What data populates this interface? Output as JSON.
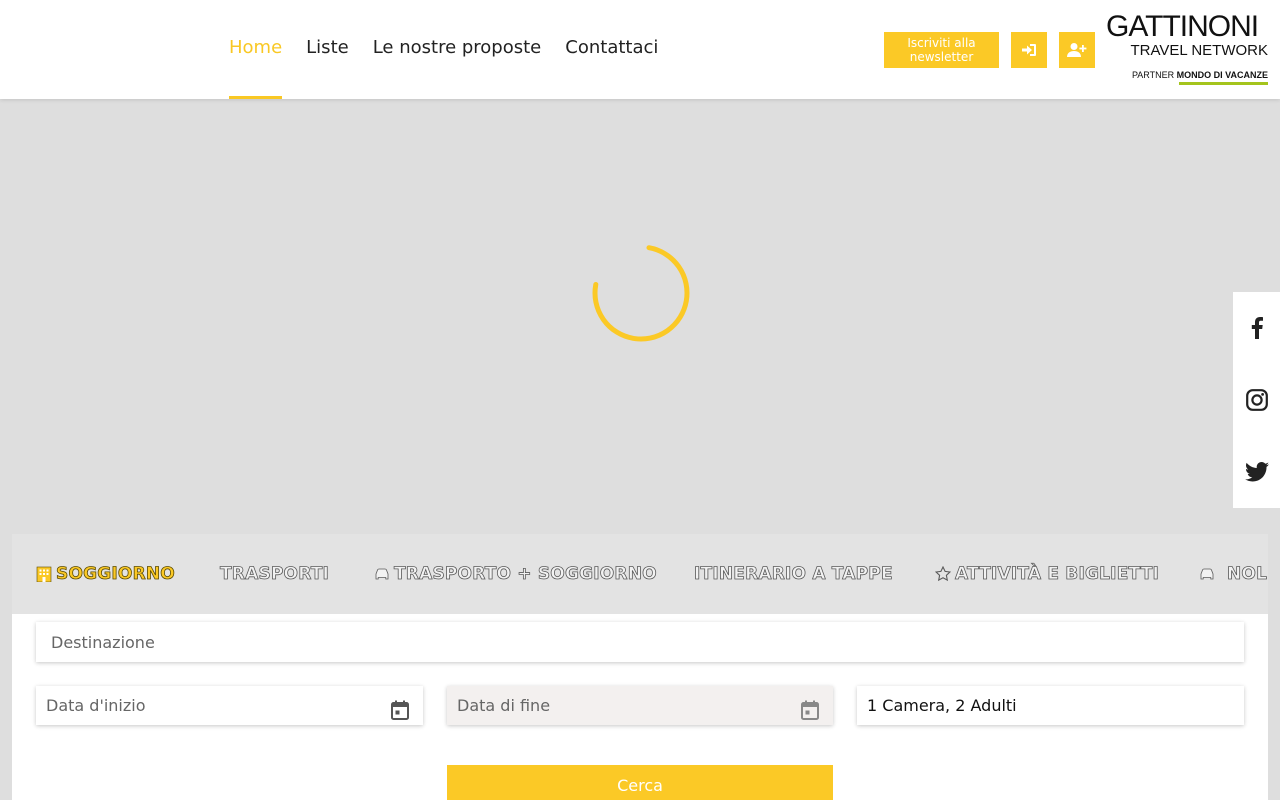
{
  "nav": {
    "items": [
      {
        "label": "Home",
        "active": true
      },
      {
        "label": "Liste"
      },
      {
        "label": "Le nostre proposte"
      },
      {
        "label": "Contattaci"
      }
    ]
  },
  "header": {
    "newsletter_label": "Iscriviti alla newsletter",
    "login_icon": "sign-in-icon",
    "register_icon": "user-plus-icon"
  },
  "logo": {
    "main": "GATTINONI",
    "sub": "TRAVEL NETWORK",
    "partner_prefix": "PARTNER",
    "partner_name": "MONDO DI VACANZE"
  },
  "social": [
    "facebook-icon",
    "instagram-icon",
    "twitter-icon"
  ],
  "tabs": [
    {
      "label": "SOGGIORNO",
      "icon": "hotel-icon",
      "active": true
    },
    {
      "label": "TRASPORTI"
    },
    {
      "label": "TRASPORTO + SOGGIORNO",
      "icon": "car-icon"
    },
    {
      "label": "ITINERARIO A TAPPE"
    },
    {
      "label": "ATTIVITÀ E BIGLIETTI",
      "icon": "star-icon"
    },
    {
      "label": "NOL",
      "icon": "car-icon"
    }
  ],
  "search": {
    "destination_placeholder": "Destinazione",
    "start_placeholder": "Data d'inizio",
    "end_placeholder": "Data di fine",
    "rooms_value": "1 Camera, 2 Adulti",
    "submit_label": "Cerca"
  },
  "colors": {
    "accent": "#fbc926",
    "logo_partner_line": "#a4c41c",
    "background": "#dedede"
  }
}
